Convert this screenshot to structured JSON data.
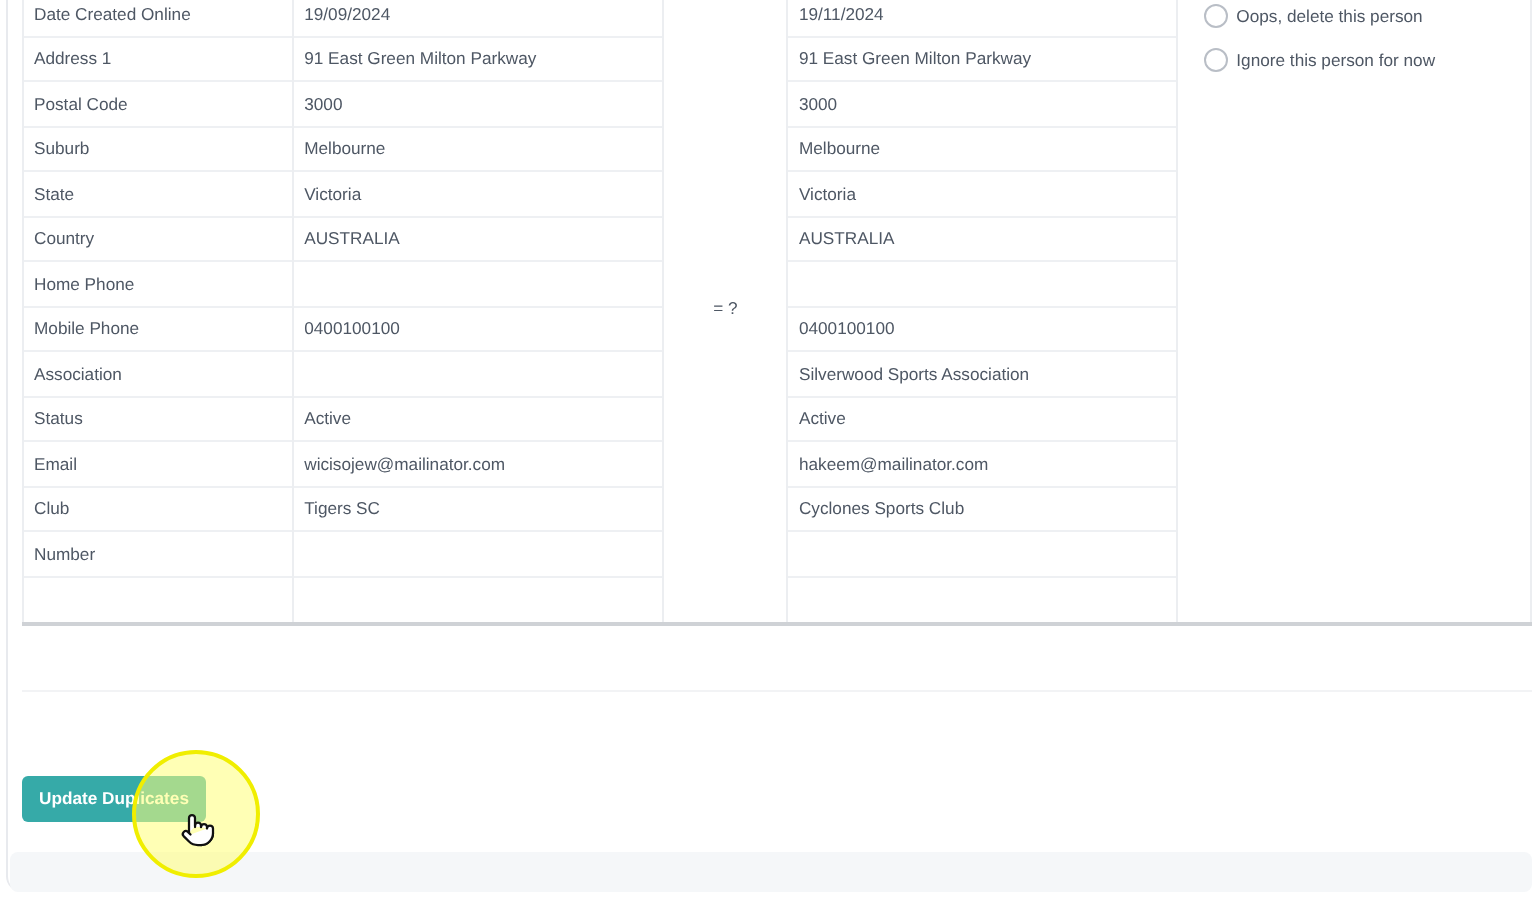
{
  "rows": [
    {
      "label": "Date Created Online",
      "value_1": "19/09/2024",
      "value_2": "19/11/2024"
    },
    {
      "label": "Address 1",
      "value_1": "91 East Green Milton Parkway",
      "value_2": "91 East Green Milton Parkway"
    },
    {
      "label": "Postal Code",
      "value_1": "3000",
      "value_2": "3000"
    },
    {
      "label": "Suburb",
      "value_1": "Melbourne",
      "value_2": "Melbourne"
    },
    {
      "label": "State",
      "value_1": "Victoria",
      "value_2": "Victoria"
    },
    {
      "label": "Country",
      "value_1": "AUSTRALIA",
      "value_2": "AUSTRALIA"
    },
    {
      "label": "Home Phone"
    },
    {
      "label": "Mobile Phone",
      "value_1": "0400100100",
      "value_2": "0400100100"
    },
    {
      "label": "Association",
      "value_2": "Silverwood Sports Association"
    },
    {
      "label": "Status",
      "value_1": "Active",
      "value_2": "Active"
    },
    {
      "label": "Email",
      "value_1": "wicisojew@mailinator.com",
      "value_2": "hakeem@mailinator.com"
    },
    {
      "label": "Club",
      "value_1": "Tigers SC",
      "value_2": "Cyclones Sports Club"
    },
    {
      "label": "Number"
    }
  ],
  "comparison_mark": "= ?",
  "options": [
    {
      "label": "Oops, delete this person",
      "selected": false
    },
    {
      "label": "Ignore this person for now",
      "selected": false
    }
  ],
  "update_button": {
    "label": "Update Duplicates"
  }
}
